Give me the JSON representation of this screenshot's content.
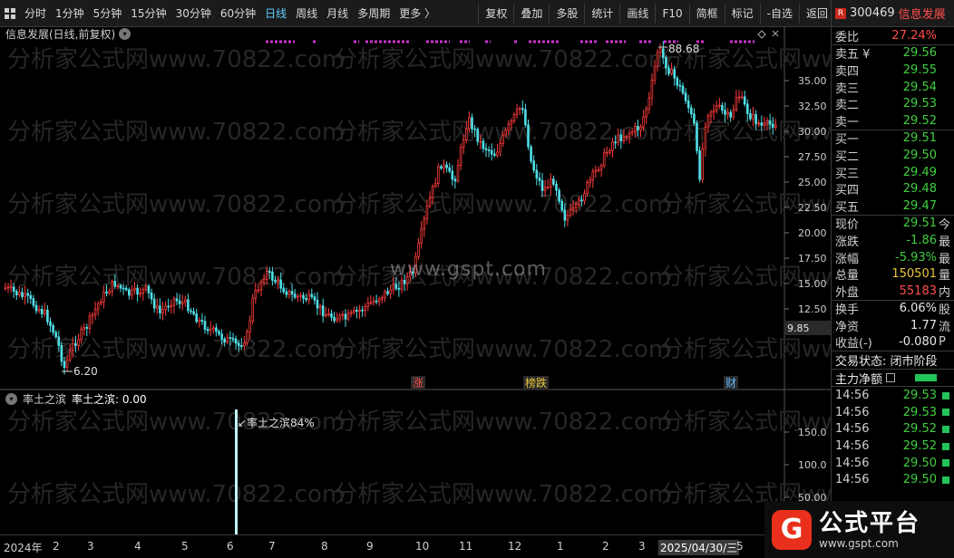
{
  "toolbar": {
    "periods": [
      "分时",
      "1分钟",
      "5分钟",
      "15分钟",
      "30分钟",
      "60分钟",
      "日线",
      "周线",
      "月线",
      "多周期",
      "更多 〉"
    ],
    "active_period": "日线",
    "tools": [
      "复权",
      "叠加",
      "多股",
      "统计",
      "画线",
      "F10",
      "简框",
      "标记",
      "-自选",
      "返回"
    ]
  },
  "chart": {
    "title": "信息发展(日线,前复权)",
    "high_label": "88.68",
    "low_label": "6.20",
    "last_price_label": "9.85",
    "y_axis_labels": [
      "35.00",
      "32.50",
      "30.00",
      "27.50",
      "25.00",
      "22.50",
      "20.00",
      "17.50",
      "15.00",
      "12.50"
    ],
    "markers": [
      "涨",
      "榜跌",
      "财"
    ],
    "sub_title": "率土之滨",
    "sub_value": "率土之滨: 0.00",
    "sub_annotation": "率土之滨84%",
    "sub_y_labels": [
      "150.0",
      "100.0",
      "50.00"
    ],
    "watermark": "www.gspt.com",
    "background_watermark": "分析家公式网www.70822.com",
    "colors": {
      "up": "#ff3b3b",
      "down": "#4fe0e8",
      "signal": "#cc33cc"
    }
  },
  "x_axis": {
    "labels": [
      "2024年",
      "2",
      "3",
      "4",
      "5",
      "6",
      "7",
      "8",
      "9",
      "10",
      "11",
      "12",
      "1",
      "2",
      "3",
      "2025/04/30/三",
      "5"
    ]
  },
  "panel": {
    "code": "300469",
    "name": "信息发展",
    "weibi": {
      "label": "委比",
      "value": "27.24%"
    },
    "asks": [
      {
        "label": "卖五 ¥",
        "price": "29.56"
      },
      {
        "label": "卖四",
        "price": "29.55"
      },
      {
        "label": "卖三",
        "price": "29.54"
      },
      {
        "label": "卖二",
        "price": "29.53"
      },
      {
        "label": "卖一",
        "price": "29.52"
      }
    ],
    "bids": [
      {
        "label": "买一",
        "price": "29.51"
      },
      {
        "label": "买二",
        "price": "29.50"
      },
      {
        "label": "买三",
        "price": "29.49"
      },
      {
        "label": "买四",
        "price": "29.48"
      },
      {
        "label": "买五",
        "price": "29.47"
      }
    ],
    "stats": [
      {
        "label": "现价",
        "value": "29.51",
        "extra": "今"
      },
      {
        "label": "涨跌",
        "value": "-1.86",
        "extra": "最"
      },
      {
        "label": "涨幅",
        "value": "-5.93%",
        "extra": "最"
      },
      {
        "label": "总量",
        "value": "150501",
        "extra": "量"
      },
      {
        "label": "外盘",
        "value": "55183",
        "extra": "内"
      }
    ],
    "stats2": [
      {
        "label": "换手",
        "value": "6.06%",
        "extra": "股"
      },
      {
        "label": "净资",
        "value": "1.77",
        "extra": "流"
      },
      {
        "label": "收益(-)",
        "value": "-0.080",
        "extra": "P"
      }
    ],
    "trade_status": "交易状态: 闭市阶段",
    "main_net": "主力净额",
    "ticks": [
      {
        "time": "14:56",
        "price": "29.53"
      },
      {
        "time": "14:56",
        "price": "29.53"
      },
      {
        "time": "14:56",
        "price": "29.52"
      },
      {
        "time": "14:56",
        "price": "29.52"
      },
      {
        "time": "14:56",
        "price": "29.50"
      },
      {
        "time": "14:56",
        "price": "29.50"
      }
    ]
  },
  "logo": {
    "text": "公式平台",
    "url": "www.gspt.com"
  }
}
